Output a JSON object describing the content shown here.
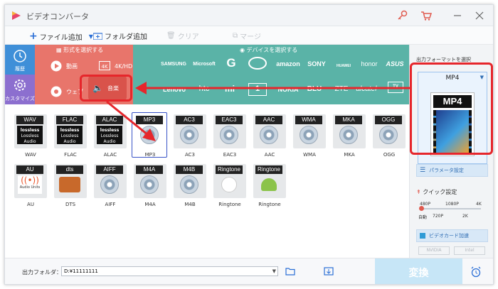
{
  "window": {
    "title": "ビデオコンバータ"
  },
  "toolbar": {
    "add_file": "ファイル追加",
    "add_folder": "フォルダ追加",
    "clear": "クリア",
    "merge": "マージ"
  },
  "sidebar": {
    "history_label": "履歴",
    "custom_label": "カスタマイズ"
  },
  "format_panel": {
    "header": "形式を選択する",
    "video": "動画",
    "hd": "4K/HD",
    "web": "ウェブ",
    "audio": "音楽"
  },
  "device_panel": {
    "header": "デバイスを選択する",
    "row1": [
      "",
      "SAMSUNG",
      "Microsoft",
      "G",
      "",
      "amazon",
      "SONY",
      "HUAWEI",
      "honor",
      "ASUS"
    ],
    "row2": [
      "Lenovo",
      "htc",
      "mi",
      "1",
      "NOKIA",
      "BLU",
      "ZTE",
      "alcatel",
      "TV"
    ]
  },
  "formats": [
    {
      "tag": "WAV",
      "label": "WAV",
      "style": "lossless"
    },
    {
      "tag": "FLAC",
      "label": "FLAC",
      "style": "lossless"
    },
    {
      "tag": "ALAC",
      "label": "ALAC",
      "style": "lossless"
    },
    {
      "tag": "MP3",
      "label": "MP3",
      "style": "disc",
      "selected": true
    },
    {
      "tag": "AC3",
      "label": "AC3",
      "style": "disc"
    },
    {
      "tag": "EAC3",
      "label": "EAC3",
      "style": "disc"
    },
    {
      "tag": "AAC",
      "label": "AAC",
      "style": "disc"
    },
    {
      "tag": "WMA",
      "label": "WMA",
      "style": "disc"
    },
    {
      "tag": "MKA",
      "label": "MKA",
      "style": "disc"
    },
    {
      "tag": "OGG",
      "label": "OGG",
      "style": "disc"
    },
    {
      "tag": "AU",
      "label": "AU",
      "style": "au"
    },
    {
      "tag": "dts",
      "label": "DTS",
      "style": "dts"
    },
    {
      "tag": "AIFF",
      "label": "AIFF",
      "style": "disc"
    },
    {
      "tag": "M4A",
      "label": "M4A",
      "style": "disc"
    },
    {
      "tag": "M4B",
      "label": "M4B",
      "style": "disc"
    },
    {
      "tag": "Ringtone",
      "label": "Ringtone",
      "style": "apple"
    },
    {
      "tag": "Ringtone",
      "label": "Ringtone",
      "style": "android"
    }
  ],
  "lossless_text": "lossless",
  "lossless_sub": "Lossless Audio",
  "au_sub": "Audio Units",
  "right_panel": {
    "output_title": "出力フォーマットを選択",
    "selected_format": "MP4",
    "param_button": "パラメータ設定",
    "quick_setting": "クイック設定",
    "ticks_top": [
      "480P",
      "1080P",
      "4K"
    ],
    "ticks_bottom": [
      "自動",
      "720P",
      "2K"
    ],
    "gpu_button": "ビデオカード加速",
    "gpu_vendors": [
      "NVIDIA",
      "Intel"
    ]
  },
  "bottom": {
    "output_folder_label": "出力フォルダ：",
    "output_path": "D:¥11111111",
    "convert_label": "変換"
  },
  "colors": {
    "format_panel": "#e8756b",
    "device_panel": "#5ab3a7",
    "sidebar_top": "#3f8fd8",
    "sidebar_bottom": "#8c6fcf",
    "highlight": "#e6262b",
    "selection": "#3953c7"
  }
}
